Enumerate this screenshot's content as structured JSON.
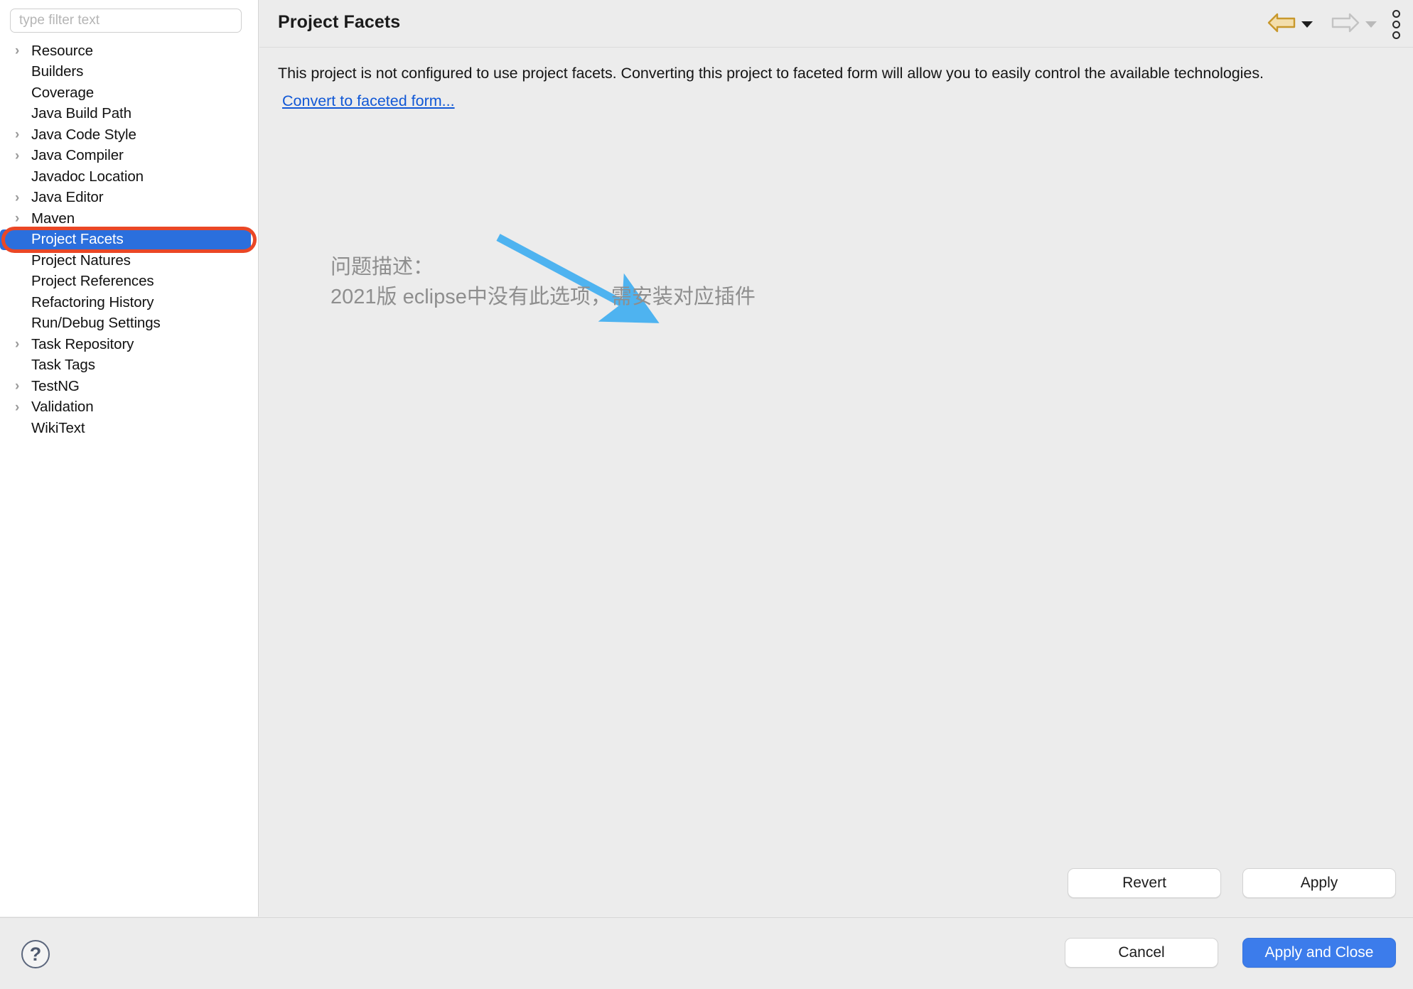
{
  "sidebar": {
    "filter": {
      "placeholder": "type filter text",
      "value": ""
    },
    "items": [
      {
        "label": "Resource",
        "expandable": true,
        "selected": false
      },
      {
        "label": "Builders",
        "expandable": false,
        "selected": false
      },
      {
        "label": "Coverage",
        "expandable": false,
        "selected": false
      },
      {
        "label": "Java Build Path",
        "expandable": false,
        "selected": false
      },
      {
        "label": "Java Code Style",
        "expandable": true,
        "selected": false
      },
      {
        "label": "Java Compiler",
        "expandable": true,
        "selected": false
      },
      {
        "label": "Javadoc Location",
        "expandable": false,
        "selected": false
      },
      {
        "label": "Java Editor",
        "expandable": true,
        "selected": false
      },
      {
        "label": "Maven",
        "expandable": true,
        "selected": false
      },
      {
        "label": "Project Facets",
        "expandable": false,
        "selected": true
      },
      {
        "label": "Project Natures",
        "expandable": false,
        "selected": false
      },
      {
        "label": "Project References",
        "expandable": false,
        "selected": false
      },
      {
        "label": "Refactoring History",
        "expandable": false,
        "selected": false
      },
      {
        "label": "Run/Debug Settings",
        "expandable": false,
        "selected": false
      },
      {
        "label": "Task Repository",
        "expandable": true,
        "selected": false
      },
      {
        "label": "Task Tags",
        "expandable": false,
        "selected": false
      },
      {
        "label": "TestNG",
        "expandable": true,
        "selected": false
      },
      {
        "label": "Validation",
        "expandable": true,
        "selected": false
      },
      {
        "label": "WikiText",
        "expandable": false,
        "selected": false
      }
    ],
    "expand_glyph": "›"
  },
  "header": {
    "title": "Project Facets",
    "back_enabled": true,
    "forward_enabled": false
  },
  "main": {
    "description": "This project is not configured to use project facets. Converting this project to faceted form will allow you to easily control the available technologies.",
    "convert_link": "Convert to faceted form..."
  },
  "annotation": {
    "line1": "问题描述：",
    "line2": "2021版 eclipse中没有此选项，需安装对应插件",
    "arrow_color": "#4eb3f0",
    "box_color": "#ea4726",
    "text_color": "#8e8e8e"
  },
  "panel_buttons": {
    "revert": "Revert",
    "apply": "Apply"
  },
  "bottom_bar": {
    "help": "?",
    "cancel": "Cancel",
    "apply_and_close": "Apply and Close"
  },
  "colors": {
    "selection_blue": "#2b6fdd",
    "primary_button": "#3c7ceb",
    "link_blue": "#1158d6",
    "back_arrow_gold": "#c8982c",
    "window_bg": "#ececec"
  }
}
